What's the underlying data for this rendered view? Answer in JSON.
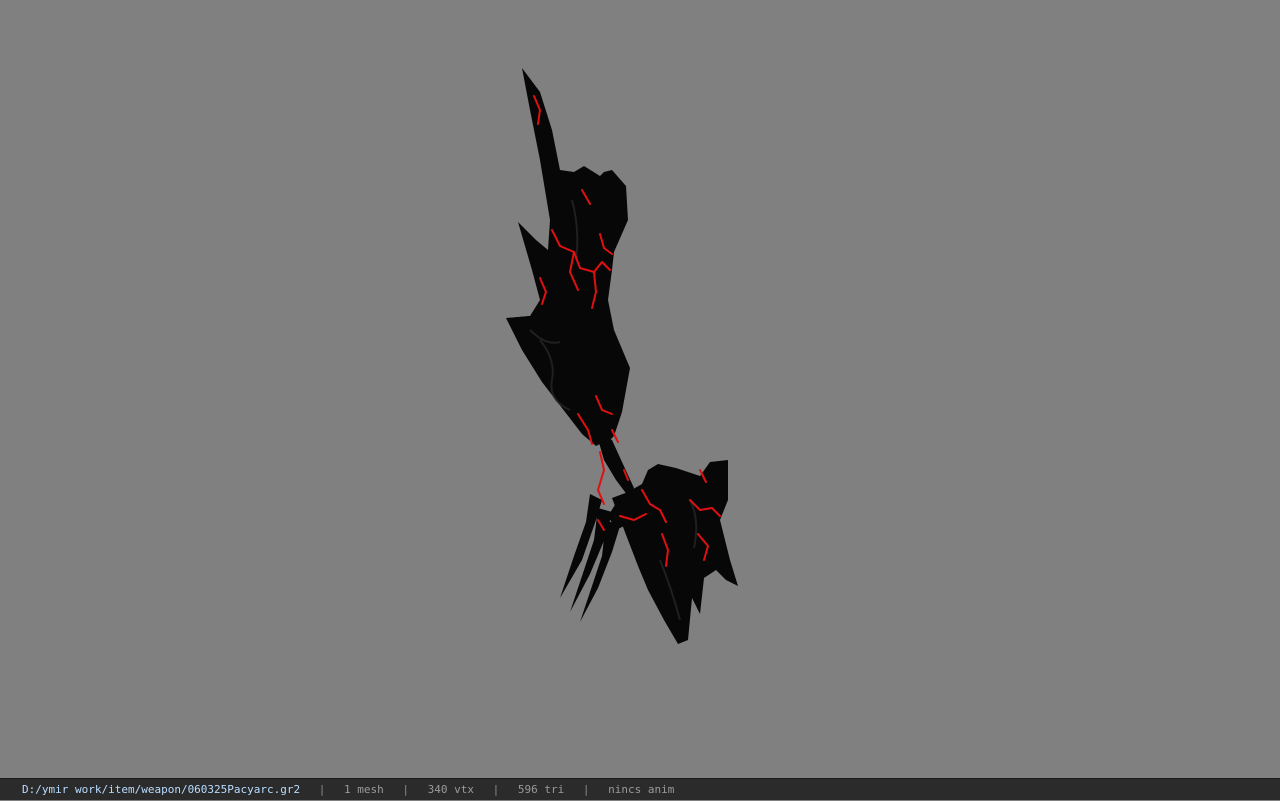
{
  "viewport": {
    "background_color": "#808080",
    "model": {
      "description_icon": "weapon-mesh-icon",
      "base_color": "#0a0a0a",
      "accent_color": "#e01010"
    }
  },
  "status_bar": {
    "file_path": "D:/ymir work/item/weapon/060325Pacyarc.gr2",
    "separator": "|",
    "mesh_count": "1 mesh",
    "vertex_count": "340 vtx",
    "triangle_count": "596 tri",
    "anim_status": "nincs anim"
  }
}
